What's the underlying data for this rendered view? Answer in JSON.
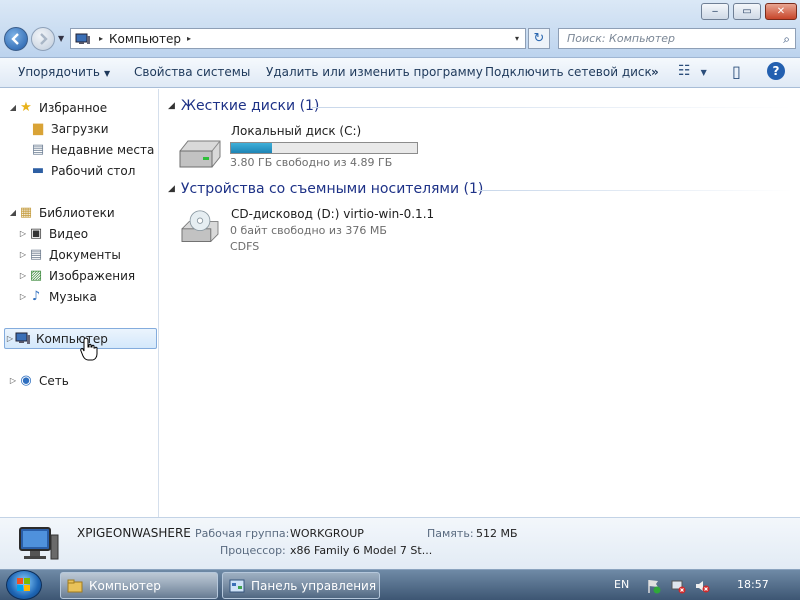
{
  "window": {
    "minimize_glyph": "‒",
    "maximize_glyph": "▭",
    "close_glyph": "✕"
  },
  "address": {
    "location": "Компьютер",
    "separator_glyph": "▸",
    "dropdown_glyph": "▾",
    "refresh_glyph": "↻"
  },
  "search": {
    "placeholder": "Поиск: Компьютер",
    "icon_glyph": "⌕"
  },
  "toolbar": {
    "organize": "Упорядочить",
    "system_properties": "Свойства системы",
    "uninstall": "Удалить или изменить программу",
    "map_drive": "Подключить сетевой диск",
    "more_glyph": "»",
    "views_glyph": "☷",
    "preview_glyph": "▯",
    "help_glyph": "?"
  },
  "nav": {
    "favorites": "Избранное",
    "downloads": "Загрузки",
    "recent": "Недавние места",
    "desktop": "Рабочий стол",
    "libraries": "Библиотеки",
    "video": "Видео",
    "documents": "Документы",
    "pictures": "Изображения",
    "music": "Музыка",
    "computer": "Компьютер",
    "network": "Сеть"
  },
  "content": {
    "hdd_group": "Жесткие диски (1)",
    "hdd_name": "Локальный диск (C:)",
    "hdd_free": "3.80 ГБ свободно из 4.89 ГБ",
    "hdd_used_fraction": 0.22,
    "removable_group": "Устройства со съемными носителями (1)",
    "cd_name": "CD-дисковод (D:) virtio-win-0.1.1",
    "cd_free": "0 байт свободно из 376 МБ",
    "cd_fs": "CDFS"
  },
  "details": {
    "computer_name": "XPIGEONWASHERE",
    "workgroup_label": "Рабочая группа:",
    "workgroup_value": "WORKGROUP",
    "memory_label": "Память:",
    "memory_value": "512 МБ",
    "cpu_label": "Процессор:",
    "cpu_value": "x86 Family 6 Model 7 St..."
  },
  "taskbar": {
    "task_computer": "Компьютер",
    "task_control_panel": "Панель управления",
    "lang": "EN",
    "clock": "18:57"
  }
}
